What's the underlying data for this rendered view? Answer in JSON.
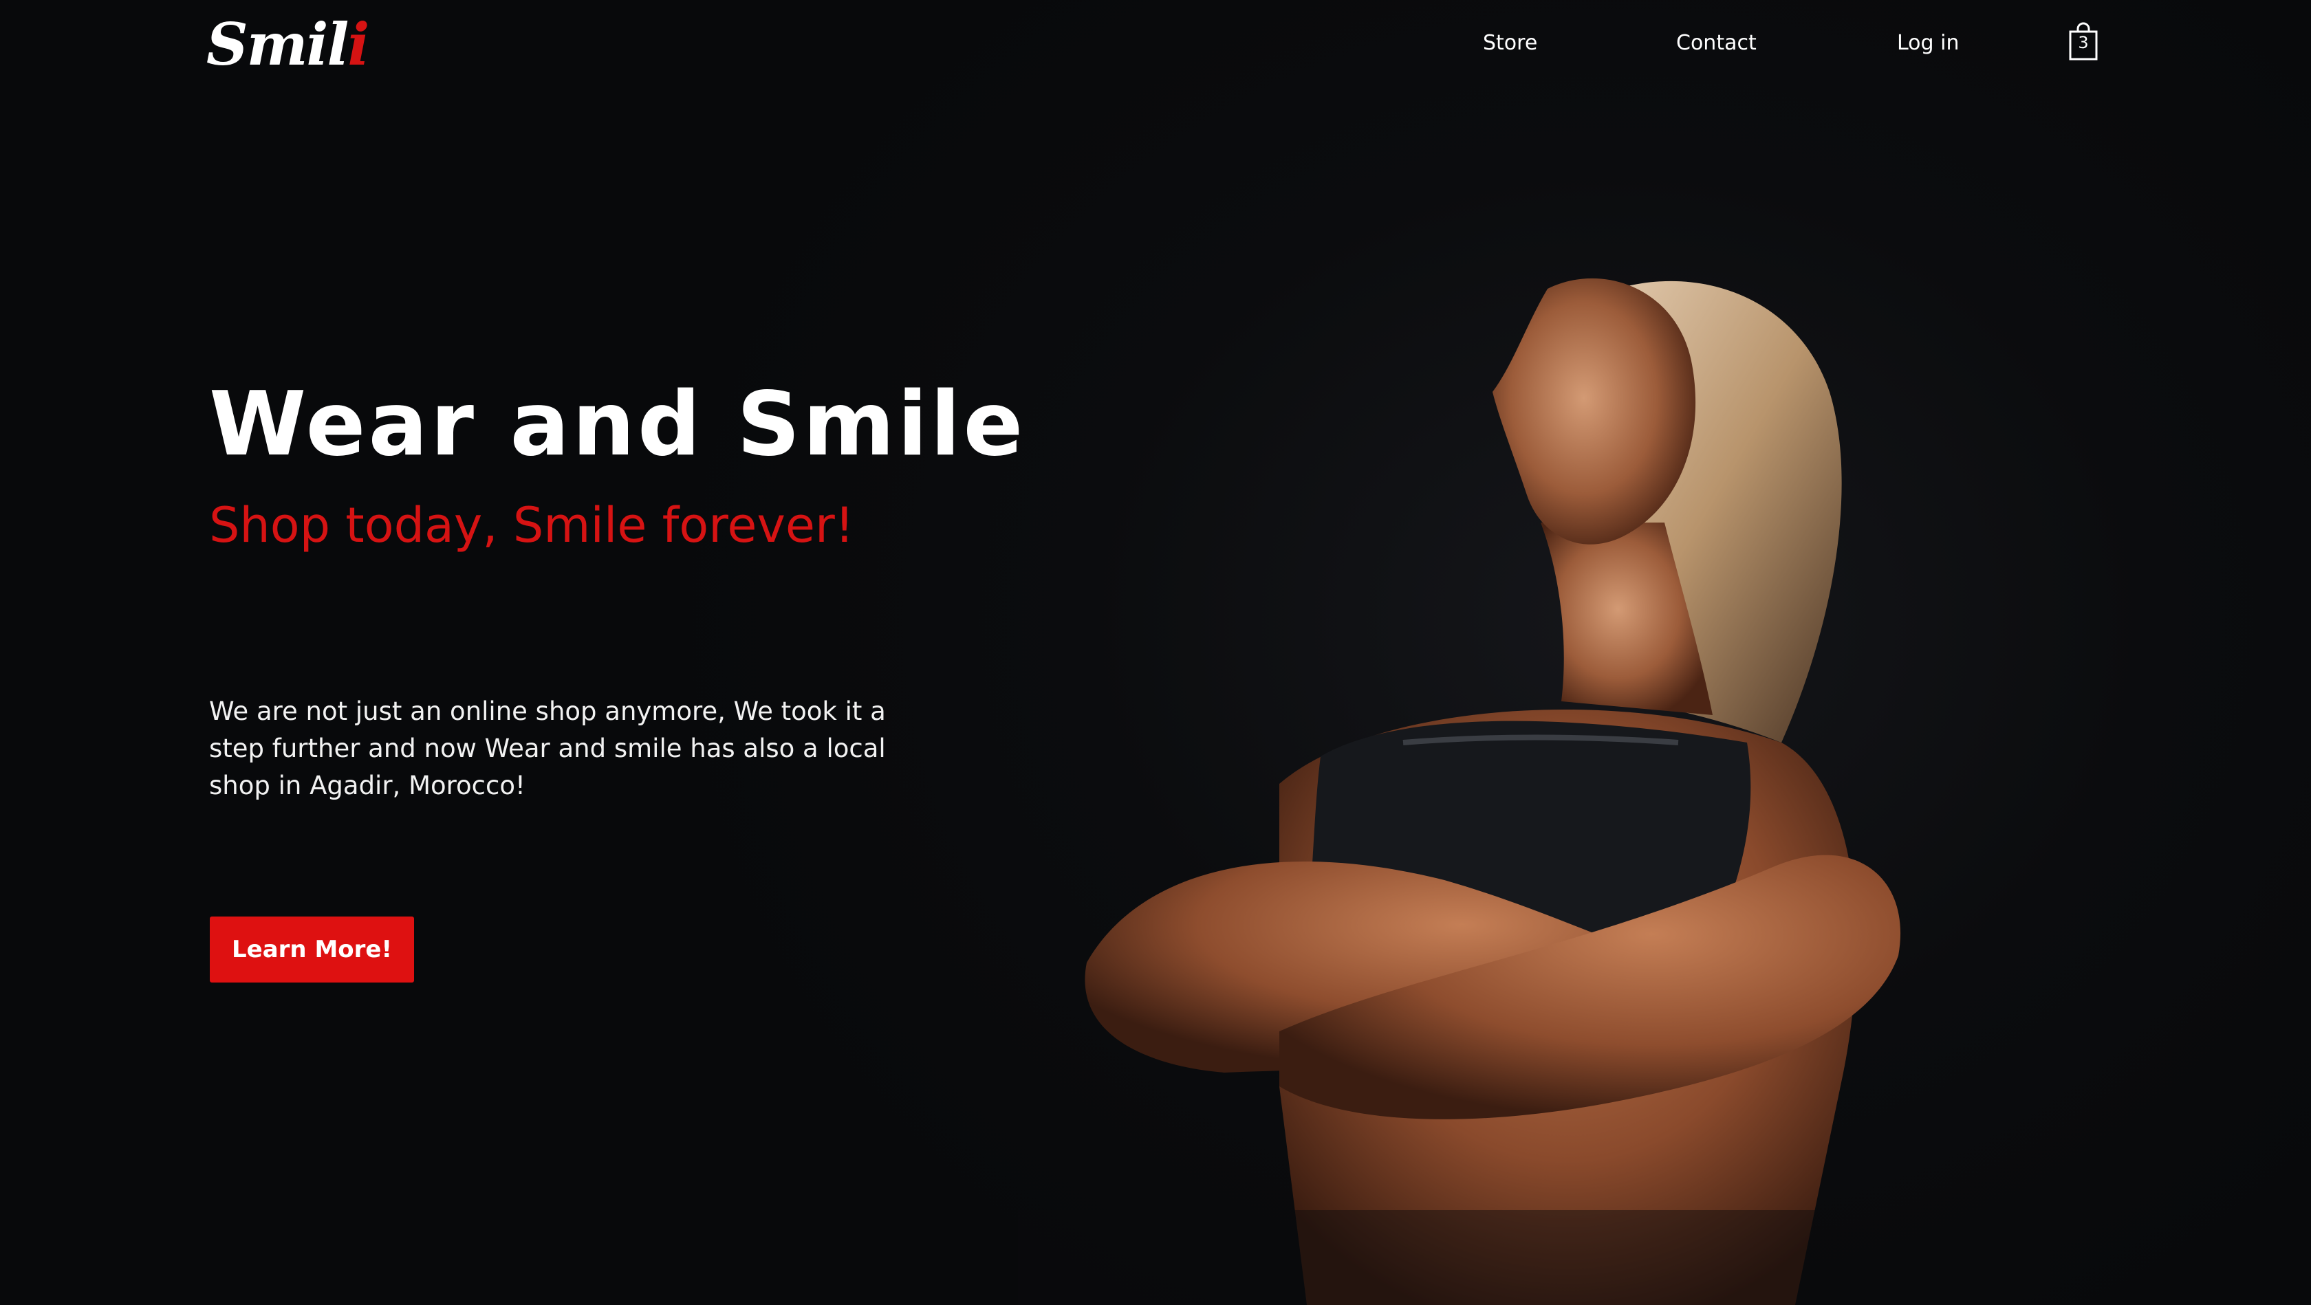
{
  "header": {
    "logo": {
      "text_main": "Smil",
      "text_accent": "i"
    },
    "nav": [
      {
        "label": "Store"
      },
      {
        "label": "Contact"
      },
      {
        "label": "Log in"
      }
    ],
    "cart": {
      "count": "3",
      "icon": "shopping-bag-icon"
    }
  },
  "hero": {
    "title": "Wear and Smile",
    "subtitle": "Shop today, Smile forever!",
    "description": "We are not just an online shop anymore, We took it a step further and now Wear and smile has also a local shop in Agadir, Morocco!",
    "cta_label": "Learn More!",
    "image": {
      "icon": "athlete-photo"
    }
  },
  "colors": {
    "background": "#0a0b0d",
    "accent": "#d61313",
    "button": "#de1111",
    "text": "#ffffff"
  }
}
